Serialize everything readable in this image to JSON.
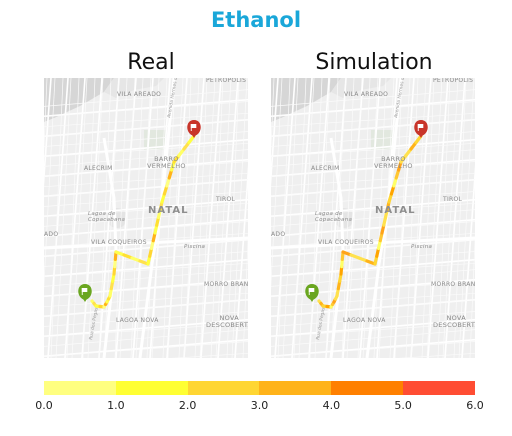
{
  "title": "Ethanol",
  "panels": [
    {
      "title": "Real"
    },
    {
      "title": "Simulation"
    }
  ],
  "map_labels": {
    "petropolis": "PETRÓPOLIS",
    "vila_areado": "VILA AREADO",
    "alecrim": "ALECRIM",
    "barro_vermelho": "BARRO\nVERMELHO",
    "natal": "NATAL",
    "tirol": "TIROL",
    "lagoa_copacabana": "Lagoa de\nCopacabana",
    "ado": "ADO",
    "vila_coqueiros": "VILA COQUEIROS",
    "piscina": "Piscina",
    "morro_branco": "MORRO BRANCO",
    "lagoa_nova": "LAGOA NOVA",
    "nova_descoberta": "NOVA\nDESCOBERTA",
    "avenida": "Avenida Hermes da Fonseca",
    "rua": "Rua dos Pegas"
  },
  "markers": {
    "start": "green-pin-icon",
    "end": "red-flag-pin-icon"
  },
  "legend": {
    "colors": [
      "#ffff80",
      "#ffff33",
      "#ffd633",
      "#ffb31a",
      "#ff8000",
      "#ff4d33"
    ],
    "ticks": [
      "0.0",
      "1.0",
      "2.0",
      "3.0",
      "4.0",
      "5.0",
      "6.0"
    ]
  }
}
